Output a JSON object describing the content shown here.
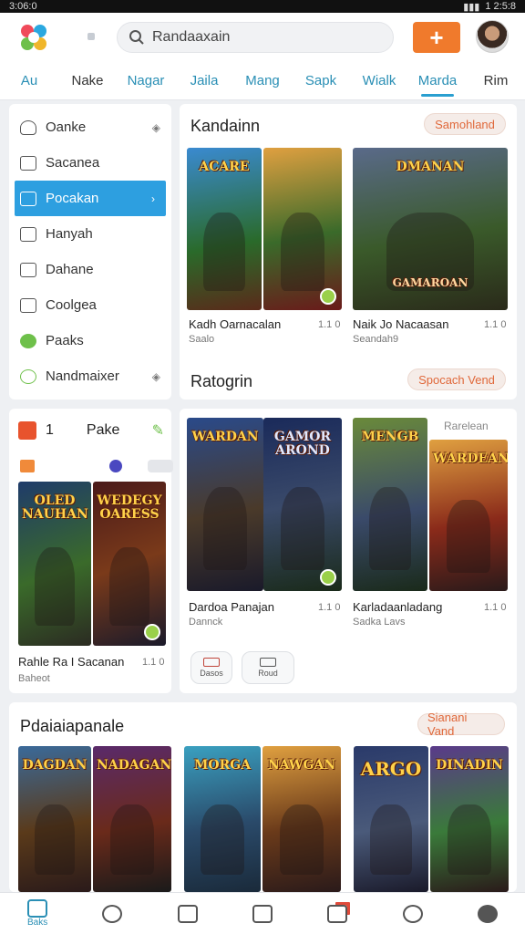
{
  "status": {
    "time": "3:06:0",
    "right": "1 2:5:8"
  },
  "search": {
    "value": "Randaaxain"
  },
  "tabs": [
    "Au",
    "Nake",
    "Nagar",
    "Jaila",
    "Mang",
    "Sapk",
    "Wialk",
    "Marda",
    "Rim"
  ],
  "sidebar": [
    {
      "label": "Oanke"
    },
    {
      "label": "Sacanea"
    },
    {
      "label": "Pocakan"
    },
    {
      "label": "Hanyah"
    },
    {
      "label": "Dahane"
    },
    {
      "label": "Coolgea"
    },
    {
      "label": "Paaks"
    },
    {
      "label": "Nandmaixer"
    }
  ],
  "pake": {
    "num": "1",
    "title": "Pake",
    "covers": [
      "OLED NAUHAN",
      "WEDEGY OARESS"
    ],
    "item_title": "Rahle Ra I Sacanan",
    "item_num": "1.1 0",
    "item_sub": "Baheot"
  },
  "section1": {
    "title": "Kandainn",
    "button": "Samohland",
    "items": [
      {
        "covers": [
          "ACARE",
          ""
        ],
        "title": "Kadh Oarnacalan",
        "num": "1.1 0",
        "sub": "Saalo"
      },
      {
        "covers": [
          "DMANAN",
          "GAMAROAN"
        ],
        "title": "Naik Jo Nacaasan",
        "num": "1.1 0",
        "sub": "Seandah9"
      }
    ]
  },
  "section2": {
    "title": "Ratogrin",
    "button": "Spocach Vend",
    "corner_label": "Rarelean",
    "items": [
      {
        "covers": [
          "WARDAN",
          "GAMOR AROND"
        ],
        "title": "Dardoa Panajan",
        "num": "1.1 0",
        "sub": "Dannck"
      },
      {
        "covers": [
          "MENGB",
          "WARDEAN"
        ],
        "title": "Karladaanladang",
        "num": "1.1 0",
        "sub": "Sadka Lavs"
      }
    ],
    "tools": [
      "Dasos",
      "Roud"
    ]
  },
  "section3": {
    "title": "Pdaiaiapanale",
    "button": "Sianani Vand",
    "covers": [
      "DAGDAN",
      "NADAGAN",
      "MORGA",
      "NAWGAN",
      "ARGO",
      "DINADIN"
    ]
  },
  "bottom_nav": [
    "Baks",
    "",
    "",
    "",
    "",
    "",
    ""
  ],
  "colors": {
    "accent": "#2d9fe0",
    "orange": "#f07a2c",
    "tab_text": "#2a8fb5"
  }
}
